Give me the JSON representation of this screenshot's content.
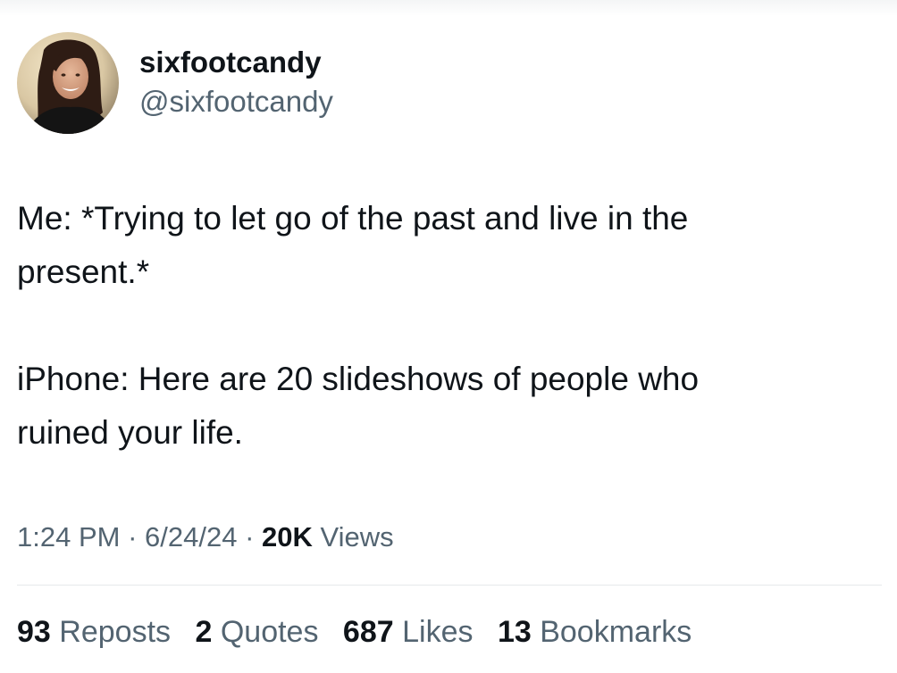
{
  "author": {
    "display_name": "sixfootcandy",
    "handle": "@sixfootcandy"
  },
  "tweet": {
    "paragraphs": [
      "Me: *Trying to let go of the past and live in the\npresent.*",
      "iPhone: Here are 20 slideshows of people who\nruined your life."
    ],
    "time": "1:24 PM",
    "separator": "·",
    "date": "6/24/24",
    "views_count": "20K",
    "views_label": "Views"
  },
  "stats": {
    "reposts": {
      "count": "93",
      "label": "Reposts"
    },
    "quotes": {
      "count": "2",
      "label": "Quotes"
    },
    "likes": {
      "count": "687",
      "label": "Likes"
    },
    "bookmarks": {
      "count": "13",
      "label": "Bookmarks"
    }
  },
  "colors": {
    "text_primary": "#0f1419",
    "text_secondary": "#536471",
    "divider": "#e6e9eb"
  }
}
